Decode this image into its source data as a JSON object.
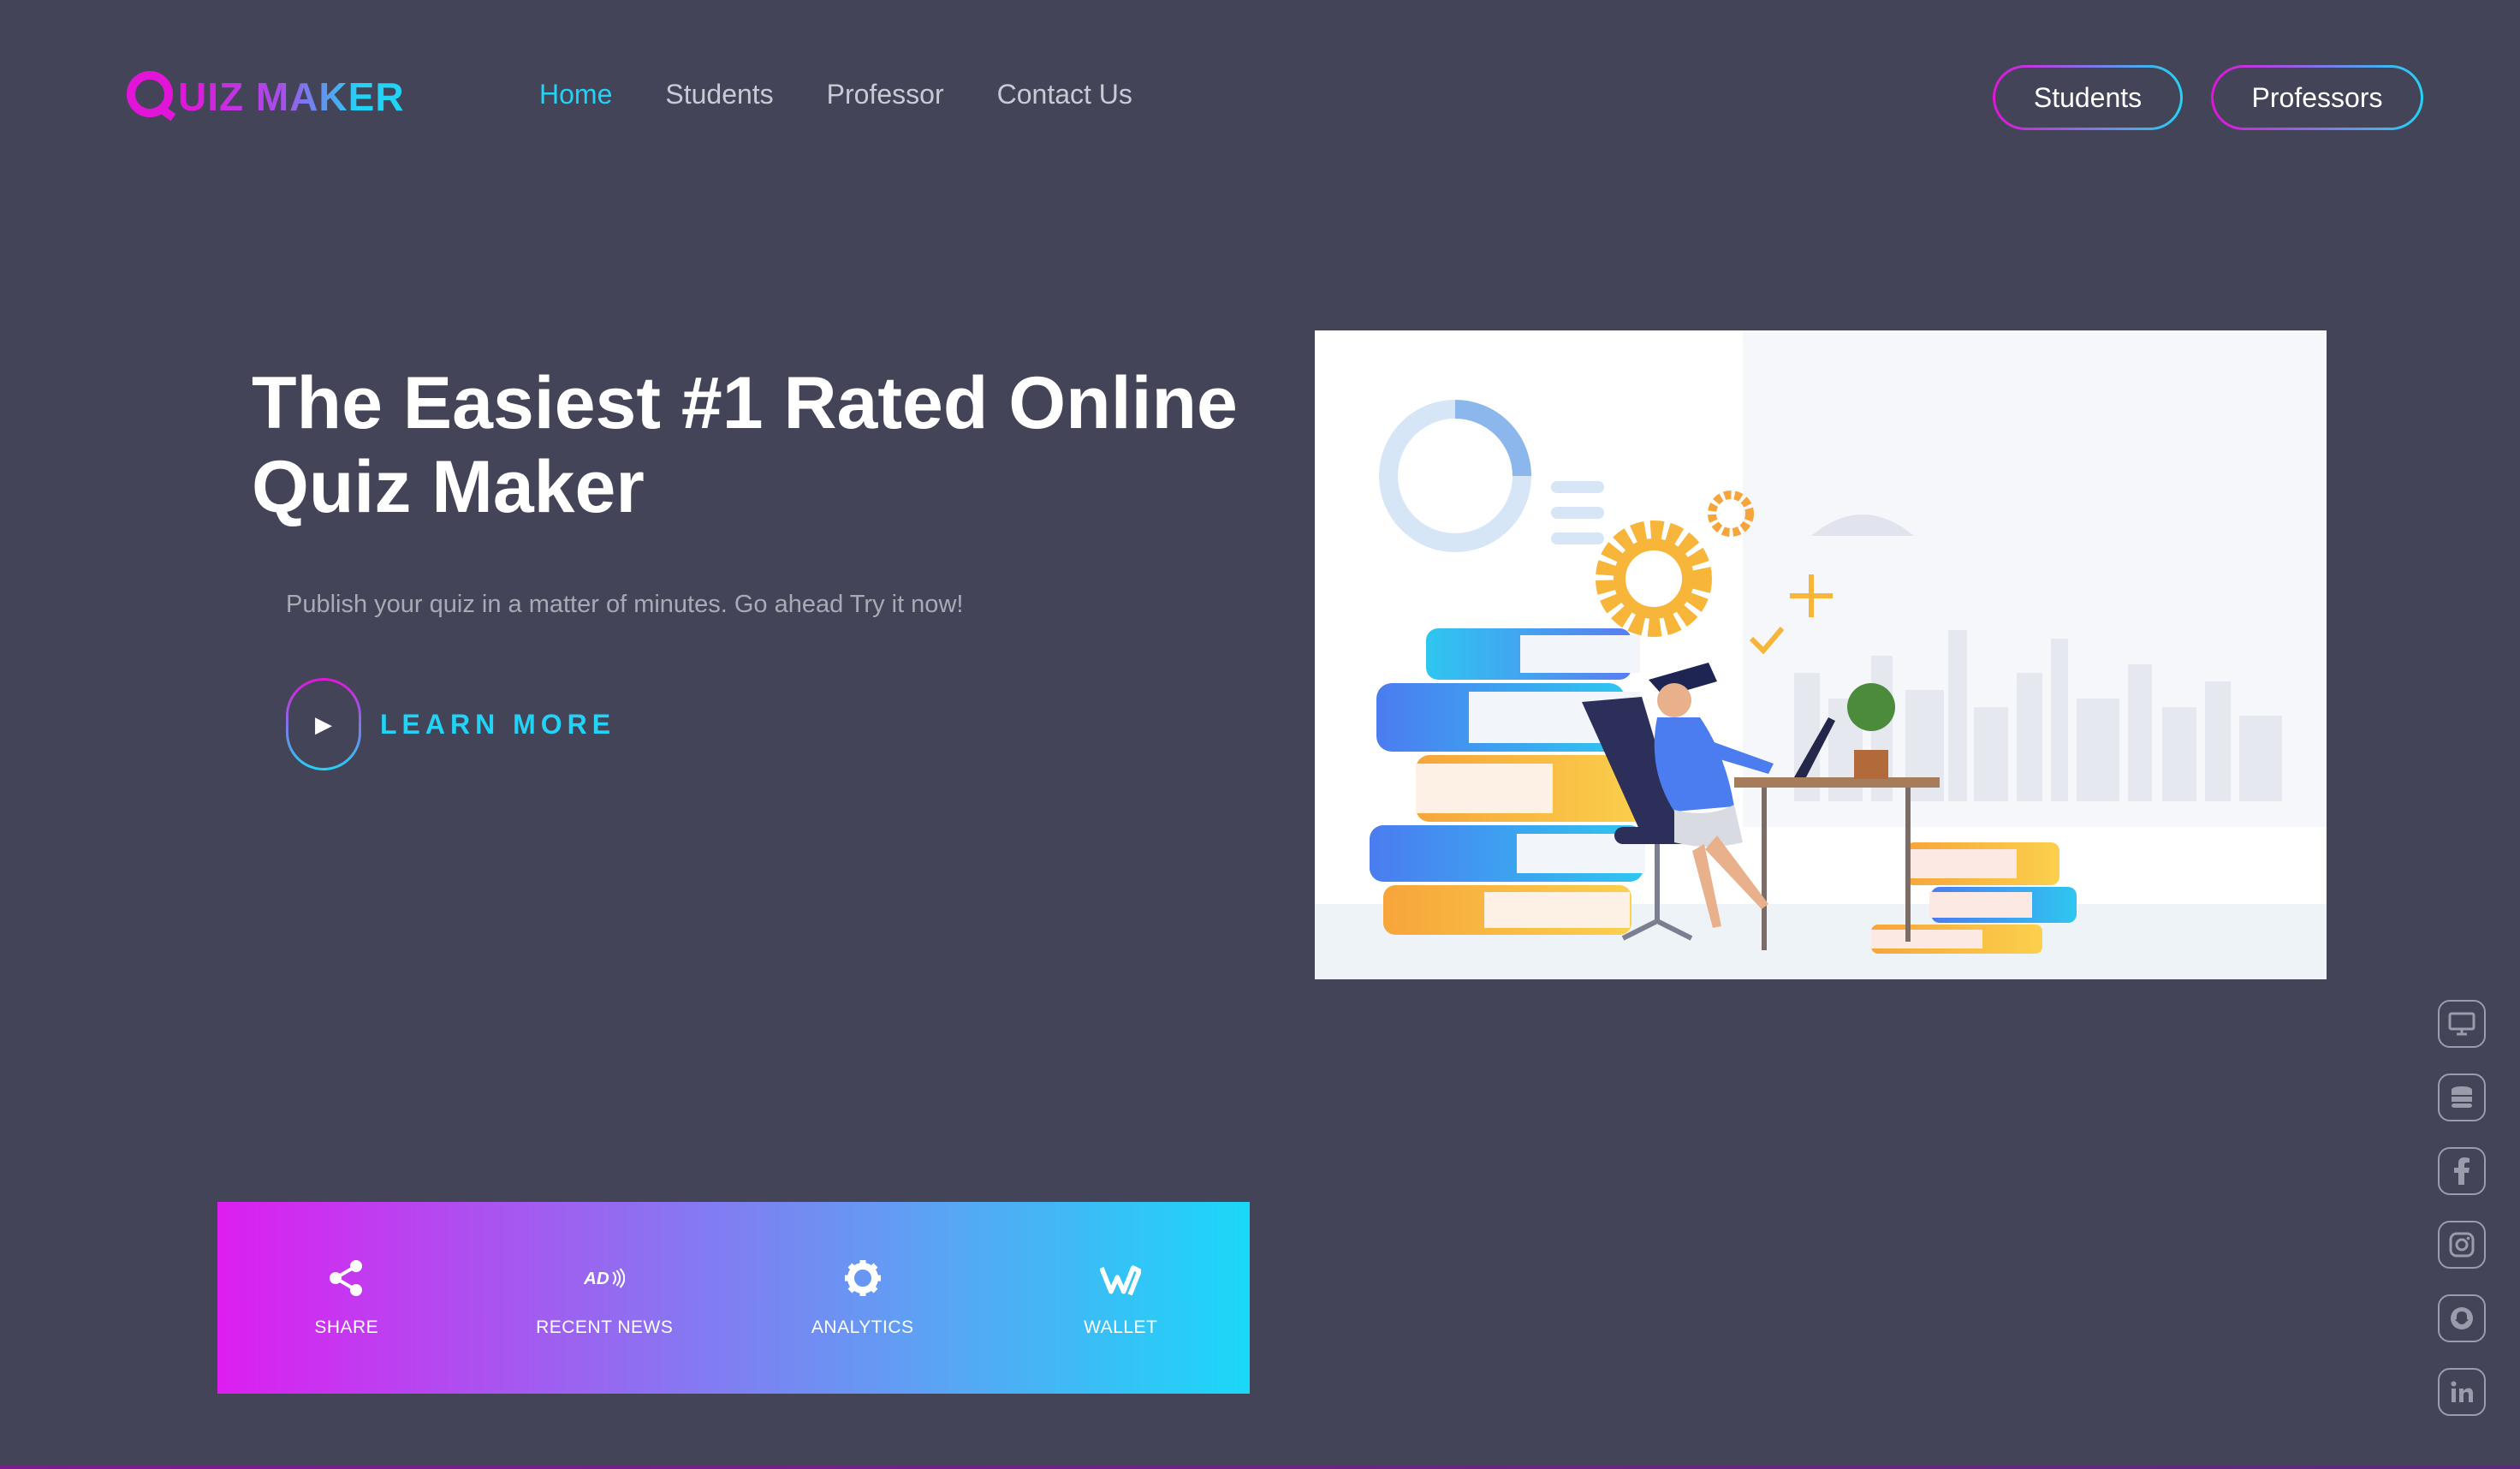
{
  "brand": {
    "logo_text": "UIZ MAKER",
    "logo_letter": "Q"
  },
  "nav": [
    {
      "label": "Home",
      "active": true
    },
    {
      "label": "Students",
      "active": false
    },
    {
      "label": "Professor",
      "active": false
    },
    {
      "label": "Contact Us",
      "active": false
    }
  ],
  "header_buttons": {
    "students": "Students",
    "professors": "Professors"
  },
  "hero": {
    "title": "The Easiest #1 Rated Online Quiz Maker",
    "subtitle": "Publish your quiz in a matter of minutes. Go ahead Try it now!",
    "cta": "LEARN MORE"
  },
  "features": [
    {
      "label": "SHARE",
      "icon": "share-icon"
    },
    {
      "label": "RECENT NEWS",
      "icon": "ad-icon"
    },
    {
      "label": "ANALYTICS",
      "icon": "gear-icon"
    },
    {
      "label": "WALLET",
      "icon": "wallet-icon"
    }
  ],
  "social": [
    "monitor-icon",
    "database-icon",
    "facebook-icon",
    "instagram-icon",
    "snapchat-icon",
    "linkedin-icon"
  ],
  "colors": {
    "background": "#434458",
    "accent_pink": "#e214d8",
    "accent_cyan": "#22d3f5"
  }
}
